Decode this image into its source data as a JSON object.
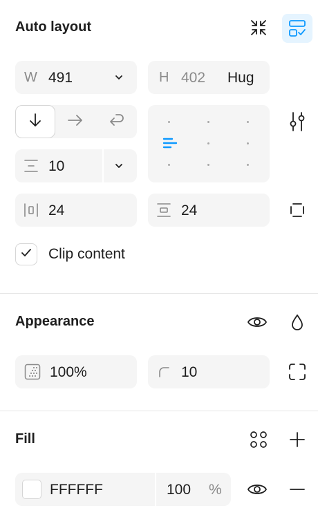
{
  "auto_layout": {
    "title": "Auto layout",
    "width": {
      "label": "W",
      "value": "491"
    },
    "height": {
      "label": "H",
      "value": "402",
      "mode": "Hug"
    },
    "gap": {
      "value": "10"
    },
    "padding_horizontal": {
      "value": "24"
    },
    "padding_vertical": {
      "value": "24"
    },
    "clip_content": {
      "label": "Clip content",
      "checked": true
    },
    "direction_selected": "vertical"
  },
  "appearance": {
    "title": "Appearance",
    "opacity": {
      "value": "100%"
    },
    "radius": {
      "value": "10"
    }
  },
  "fill": {
    "title": "Fill",
    "hex": "FFFFFF",
    "opacity": "100",
    "unit": "%"
  },
  "colors": {
    "accent": "#0d99ff",
    "accent_bg": "#e5f4ff"
  }
}
